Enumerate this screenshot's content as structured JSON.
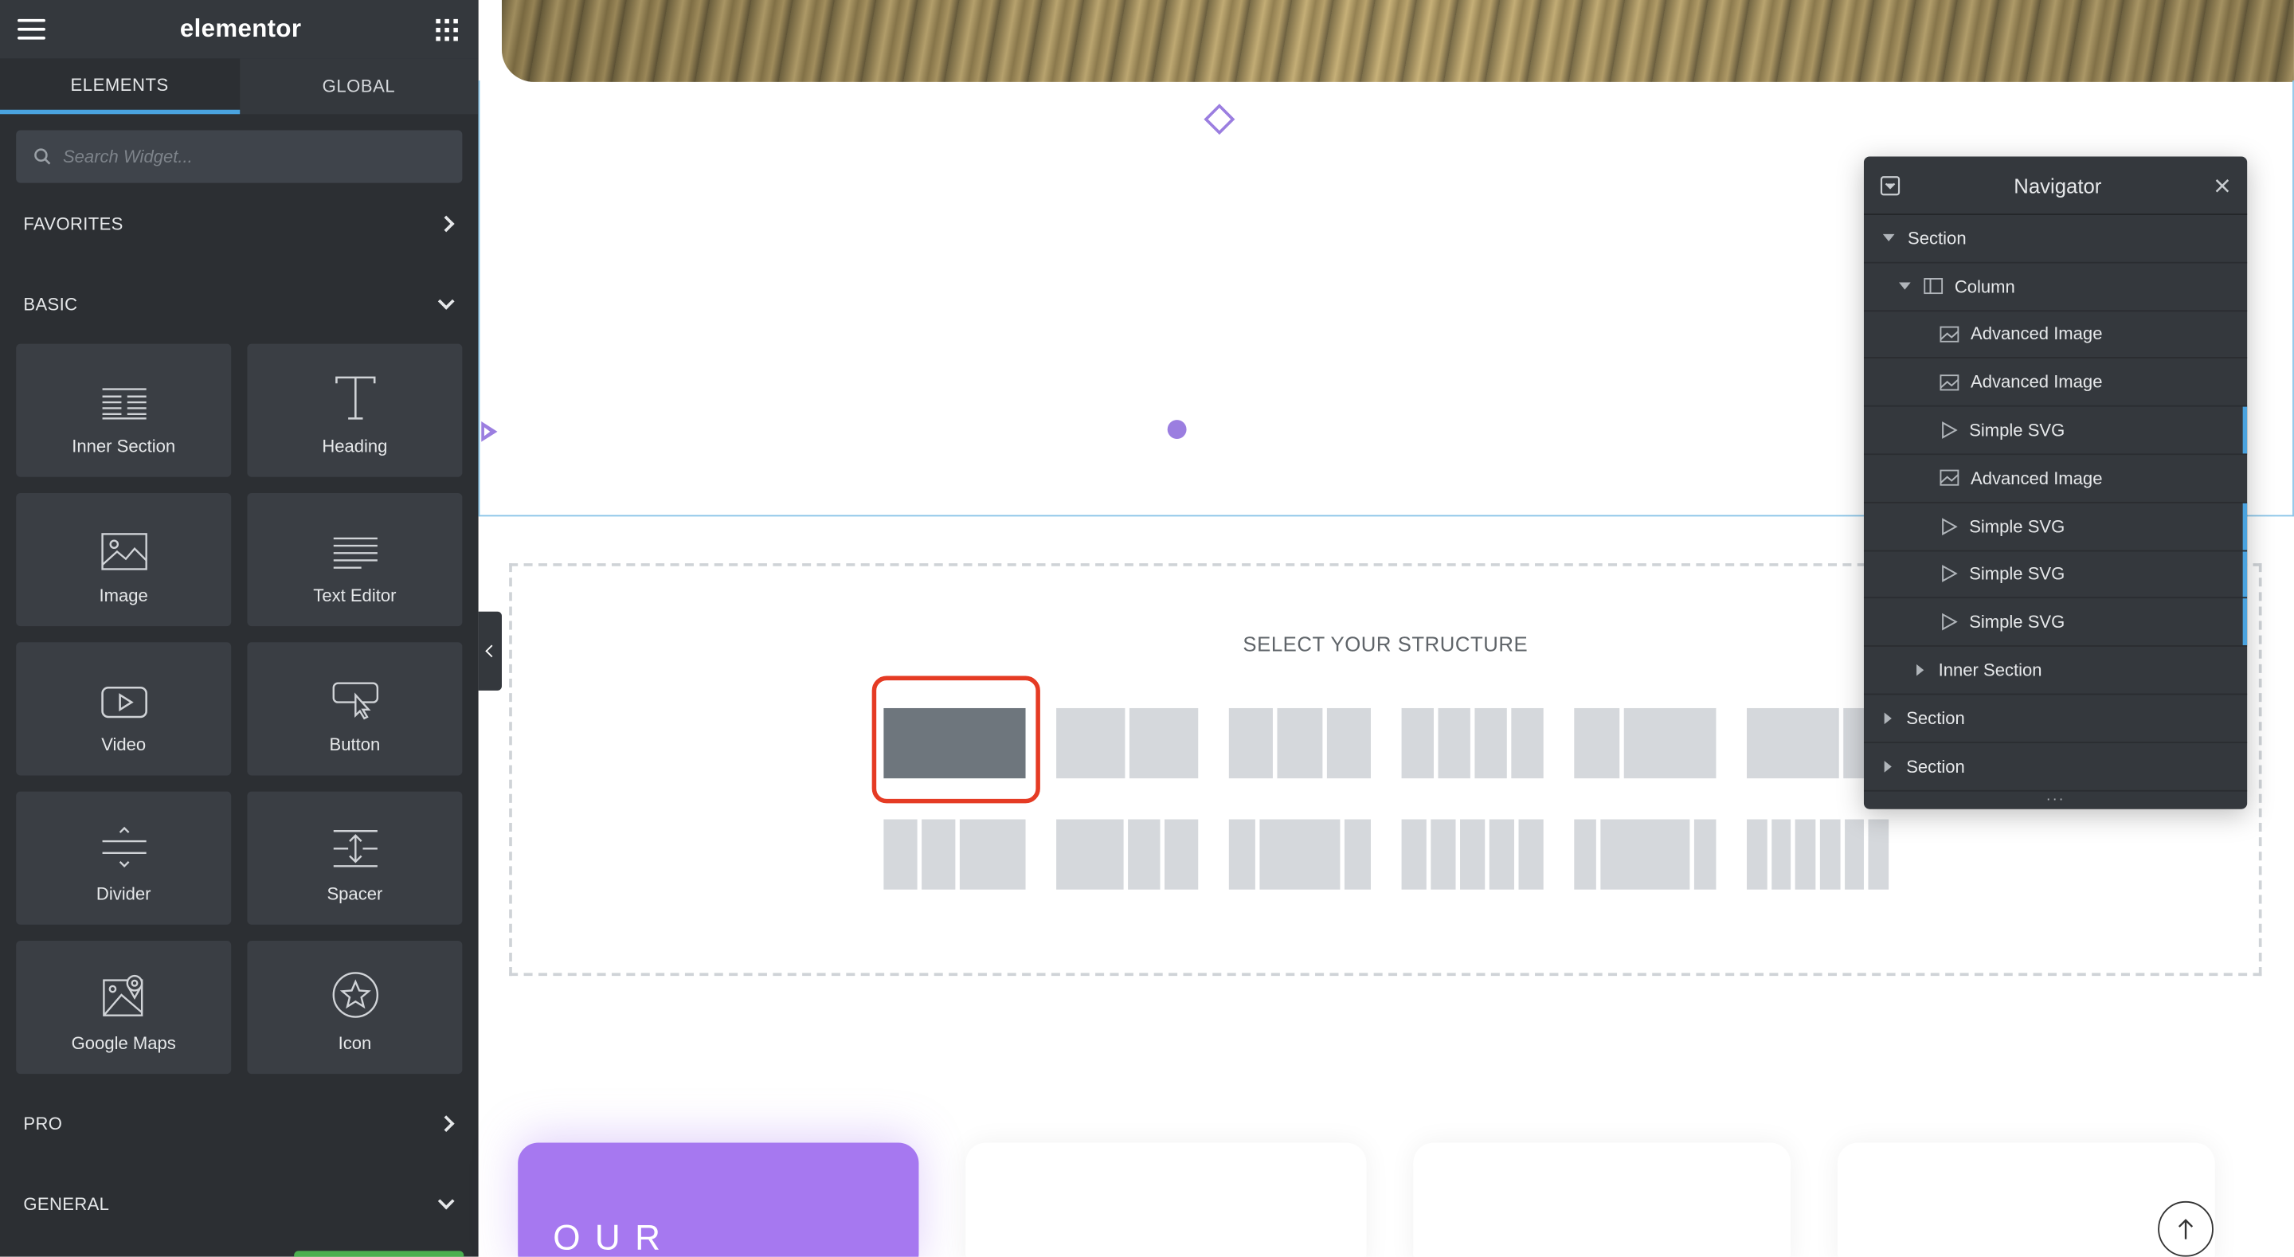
{
  "panel": {
    "brand": "elementor",
    "tabs": [
      {
        "label": "ELEMENTS"
      },
      {
        "label": "GLOBAL"
      }
    ],
    "search_placeholder": "Search Widget...",
    "categories": {
      "favorites": "FAVORITES",
      "basic": "BASIC",
      "pro": "PRO",
      "general": "GENERAL"
    },
    "widgets": [
      {
        "label": "Inner Section",
        "icon": "inner-section-icon"
      },
      {
        "label": "Heading",
        "icon": "heading-icon"
      },
      {
        "label": "Image",
        "icon": "image-icon"
      },
      {
        "label": "Text Editor",
        "icon": "text-editor-icon"
      },
      {
        "label": "Video",
        "icon": "video-icon"
      },
      {
        "label": "Button",
        "icon": "button-icon"
      },
      {
        "label": "Divider",
        "icon": "divider-icon"
      },
      {
        "label": "Spacer",
        "icon": "spacer-icon"
      },
      {
        "label": "Google Maps",
        "icon": "google-maps-icon"
      },
      {
        "label": "Icon",
        "icon": "star-icon"
      }
    ]
  },
  "canvas": {
    "structure_title": "SELECT YOUR STRUCTURE",
    "card_text": "OUR"
  },
  "navigator": {
    "title": "Navigator",
    "items": [
      {
        "label": "Section"
      },
      {
        "label": "Column"
      },
      {
        "label": "Advanced Image"
      },
      {
        "label": "Advanced Image"
      },
      {
        "label": "Simple SVG"
      },
      {
        "label": "Advanced Image"
      },
      {
        "label": "Simple SVG"
      },
      {
        "label": "Simple SVG"
      },
      {
        "label": "Simple SVG"
      },
      {
        "label": "Inner Section"
      },
      {
        "label": "Section"
      },
      {
        "label": "Section"
      }
    ]
  },
  "colors": {
    "panel_bg": "#2c2f33",
    "accent_blue": "#4aa3df",
    "selection_red": "#e53b24",
    "brand_purple": "#a678f0",
    "preset_gray": "#d5d8dc"
  }
}
